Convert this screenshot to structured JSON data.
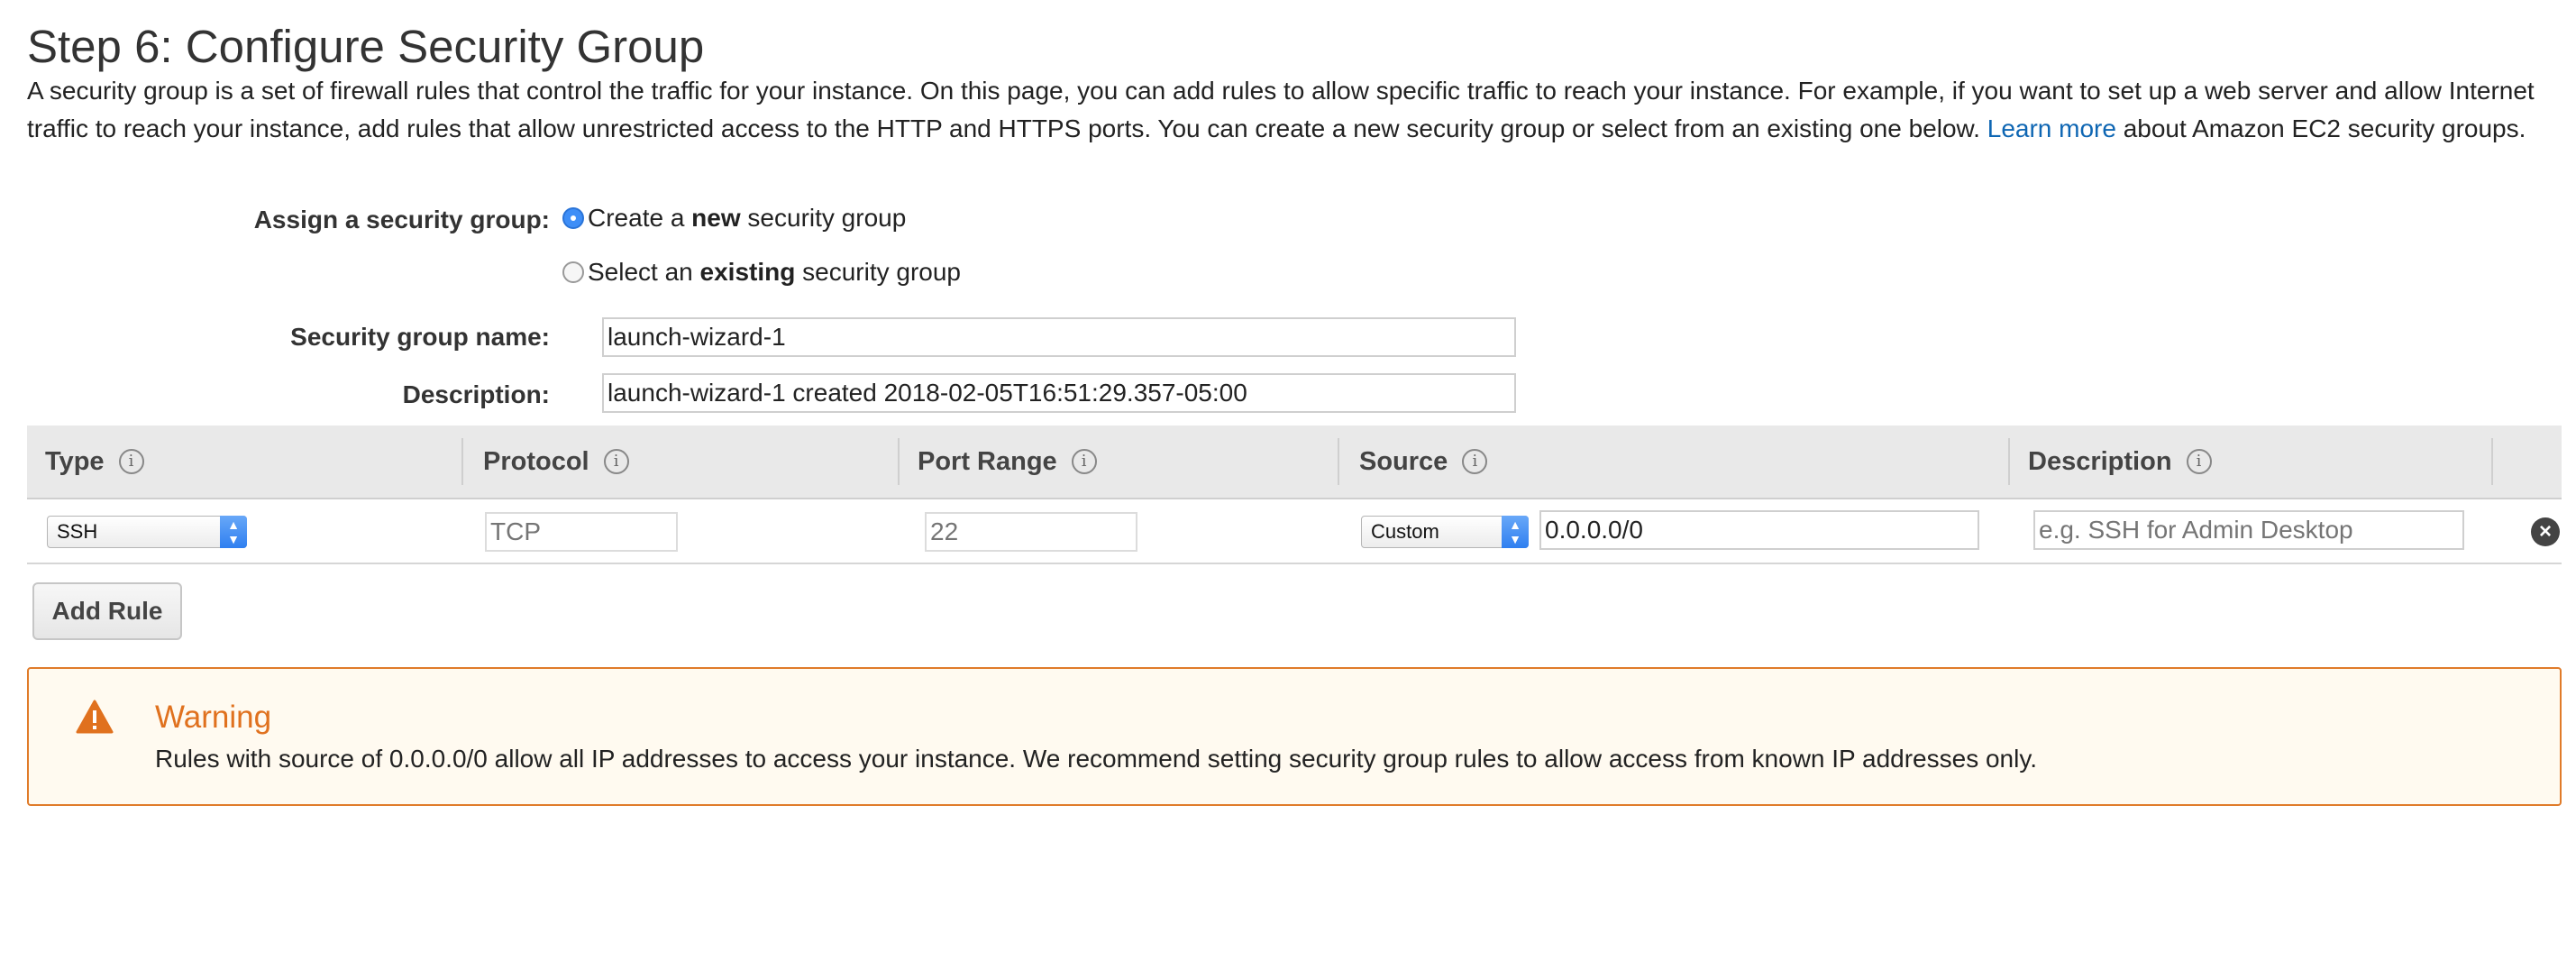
{
  "title": "Step 6: Configure Security Group",
  "intro": {
    "text_before": "A security group is a set of firewall rules that control the traffic for your instance. On this page, you can add rules to allow specific traffic to reach your instance. For example, if you want to set up a web server and allow Internet traffic to reach your instance, add rules that allow unrestricted access to the HTTP and HTTPS ports. You can create a new security group or select from an existing one below.",
    "link": "Learn more",
    "text_after": "about Amazon EC2 security groups."
  },
  "assign": {
    "label": "Assign a security group:",
    "option_new": {
      "pre": "Create a ",
      "bold": "new",
      "post": " security group",
      "selected": true
    },
    "option_existing": {
      "pre": "Select an ",
      "bold": "existing",
      "post": " security group",
      "selected": false
    }
  },
  "group_name": {
    "label": "Security group name:",
    "value": "launch-wizard-1"
  },
  "description": {
    "label": "Description:",
    "value": "launch-wizard-1 created 2018-02-05T16:51:29.357-05:00"
  },
  "table": {
    "headers": [
      "Type",
      "Protocol",
      "Port Range",
      "Source",
      "Description"
    ],
    "info_glyph": "i",
    "rows": [
      {
        "type": "SSH",
        "protocol_placeholder": "TCP",
        "port_placeholder": "22",
        "source_type": "Custom",
        "source_value": "0.0.0.0/0",
        "description_placeholder": "e.g. SSH for Admin Desktop"
      }
    ],
    "delete_glyph": "×"
  },
  "add_rule_label": "Add Rule",
  "warning": {
    "title": "Warning",
    "text": "Rules with source of 0.0.0.0/0 allow all IP addresses to access your instance. We recommend setting security group rules to allow access from known IP addresses only."
  },
  "colors": {
    "link": "#0e66b3",
    "radio_selected": "#3e8ef7",
    "warning_border": "#e07b29",
    "warning_title": "#e0711e",
    "warning_bg": "#fffaf0"
  },
  "icons": {
    "info": "info-icon",
    "select_arrows": "chevron-updown-icon",
    "delete": "close-circle-icon",
    "warning": "warning-triangle-icon"
  }
}
